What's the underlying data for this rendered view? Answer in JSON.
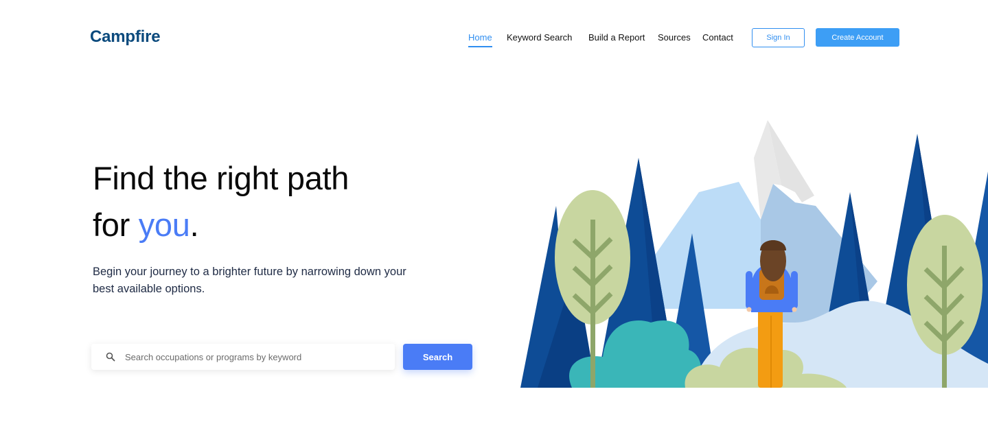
{
  "brand": {
    "name": "Campfire"
  },
  "nav": {
    "items": [
      {
        "label": "Home",
        "active": true
      },
      {
        "label": "Keyword Search",
        "active": false
      },
      {
        "label": "Build a Report",
        "active": false
      },
      {
        "label": "Sources",
        "active": false
      },
      {
        "label": "Contact",
        "active": false
      }
    ],
    "sign_in": "Sign In",
    "create_account": "Create Account"
  },
  "hero": {
    "title_line1": "Find the right path",
    "title_line2_prefix": "for ",
    "title_line2_accent": "you",
    "title_line2_suffix": ".",
    "subtitle": "Begin your journey to a brighter future by narrowing down your best available options."
  },
  "search": {
    "placeholder": "Search occupations or programs by keyword",
    "button_label": "Search"
  },
  "colors": {
    "brand": "#0b4a7d",
    "accent": "#4a7cf6",
    "nav_active": "#2f8ef0"
  },
  "illustration": {
    "icon": "hiker-mountain-forest-illustration"
  }
}
